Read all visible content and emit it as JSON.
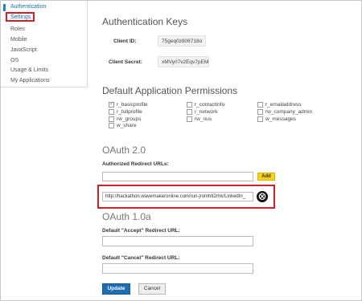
{
  "sidebar": {
    "items": [
      {
        "label": "Authentication"
      },
      {
        "label": "Settings"
      },
      {
        "label": "Roles"
      },
      {
        "label": "Mobile"
      },
      {
        "label": "JavaScript"
      },
      {
        "label": "OS"
      },
      {
        "label": "Usage & Limits"
      },
      {
        "label": "My Applications"
      }
    ]
  },
  "auth_keys": {
    "title": "Authentication Keys",
    "client_id_label": "Client ID:",
    "client_id_value": "75geq0z808718o",
    "client_secret_label": "Client Secret:",
    "client_secret_value": "xMVyrl7v2Eqv7pEM"
  },
  "permissions": {
    "title": "Default Application Permissions",
    "items": [
      {
        "label": "r_basicprofile",
        "checked": true
      },
      {
        "label": "r_fullprofile",
        "checked": false
      },
      {
        "label": "rw_groups",
        "checked": false
      },
      {
        "label": "w_share",
        "checked": false
      },
      {
        "label": "r_contactinfo",
        "checked": false
      },
      {
        "label": "r_network",
        "checked": false
      },
      {
        "label": "rw_nus",
        "checked": false
      },
      {
        "label": "r_emailaddress",
        "checked": false
      },
      {
        "label": "rw_company_admin",
        "checked": false
      },
      {
        "label": "w_messages",
        "checked": false
      }
    ]
  },
  "oauth2": {
    "title": "OAuth 2.0",
    "redirect_label": "Authorized Redirect URLs:",
    "add_label": "Add",
    "redirect_url": "http://hackathon.wavemakeronline.com/run-jromh82rhk/LinkedIn_",
    "remove_icon": "⨂"
  },
  "oauth1": {
    "title": "OAuth 1.0a",
    "accept_label": "Default \"Accept\" Redirect URL:",
    "cancel_label": "Default \"Cancel\" Redirect URL:"
  },
  "actions": {
    "update_label": "Update",
    "cancel_label": "Cancel"
  }
}
